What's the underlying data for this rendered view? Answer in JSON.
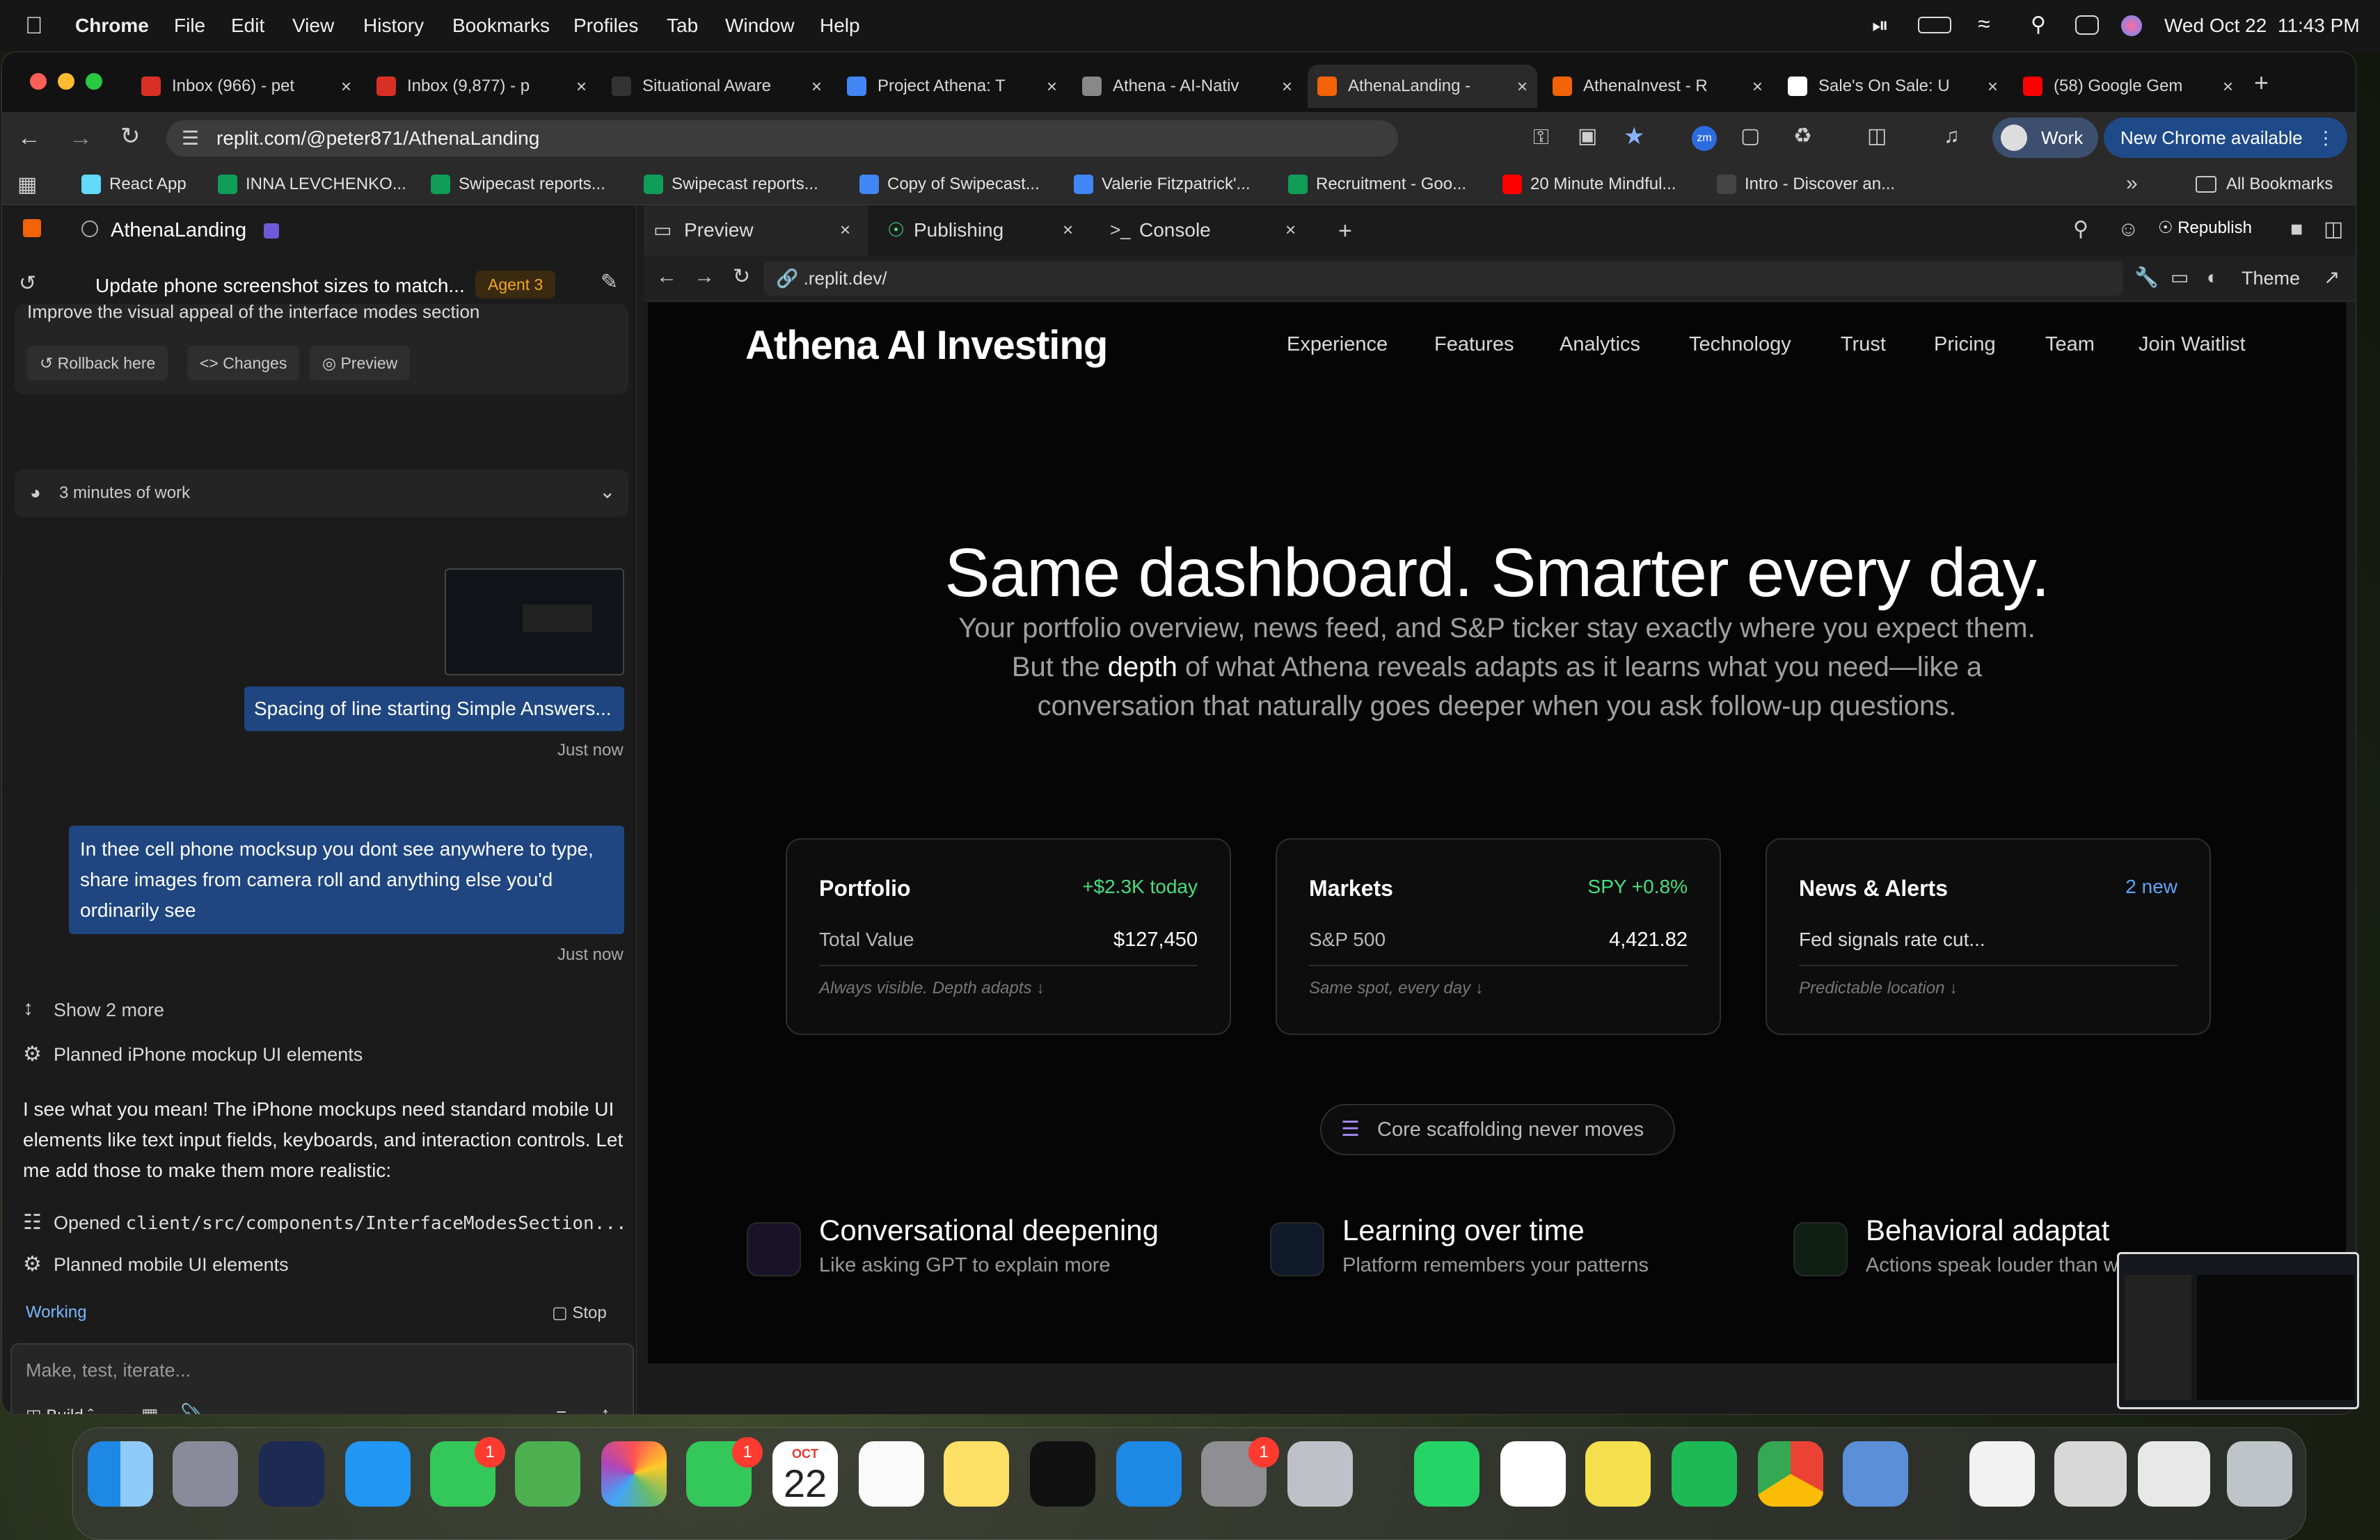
{
  "menubar": {
    "app": "Chrome",
    "items": [
      "File",
      "Edit",
      "View",
      "History",
      "Bookmarks",
      "Profiles",
      "Tab",
      "Window",
      "Help"
    ],
    "datetime": "Wed Oct 22  11:43 PM"
  },
  "tabs": [
    {
      "label": "Inbox (966) - pet",
      "color": "#d93025"
    },
    {
      "label": "Inbox (9,877) - p",
      "color": "#d93025"
    },
    {
      "label": "Situational Aware",
      "color": "#333333"
    },
    {
      "label": "Project Athena: T",
      "color": "#4285f4"
    },
    {
      "label": "Athena - AI-Nativ",
      "color": "#888888"
    },
    {
      "label": "AthenaLanding -",
      "color": "#f26207"
    },
    {
      "label": "AthenaInvest - R",
      "color": "#f26207"
    },
    {
      "label": "Sale's On Sale: U",
      "color": "#ffffff"
    },
    {
      "label": "(58) Google Gem",
      "color": "#ff0000"
    }
  ],
  "toolbar": {
    "url": "replit.com/@peter871/AthenaLanding",
    "profile_label": "Work",
    "update_label": "New Chrome available"
  },
  "bookmarks": [
    {
      "label": "React App",
      "color": "#61dafb"
    },
    {
      "label": "INNA LEVCHENKO...",
      "color": "#0f9d58"
    },
    {
      "label": "Swipecast reports...",
      "color": "#0f9d58"
    },
    {
      "label": "Swipecast reports...",
      "color": "#0f9d58"
    },
    {
      "label": "Copy of Swipecast...",
      "color": "#4285f4"
    },
    {
      "label": "Valerie Fitzpatrick'...",
      "color": "#4285f4"
    },
    {
      "label": "Recruitment - Goo...",
      "color": "#0f9d58"
    },
    {
      "label": "20 Minute Mindful...",
      "color": "#ff0000"
    },
    {
      "label": "Intro - Discover an...",
      "color": "#444444"
    }
  ],
  "bookmarks_all": "All Bookmarks",
  "replit": {
    "project": "AthenaLanding",
    "thread_title": "Update phone screenshot sizes to match...",
    "agent_badge": "Agent 3",
    "cut_text": "Improve the visual appeal of the interface modes section",
    "rollback": "Rollback here",
    "changes": "Changes",
    "preview": "Preview",
    "work_time": "3 minutes of work",
    "msg1": "Spacing of line starting Simple Answers...",
    "msg1_time": "Just now",
    "msg2": "In thee cell phone mocksup you dont see anywhere to type, share images from camera roll and anything else you'd ordinarily see",
    "msg2_time": "Just now",
    "show_more": "Show 2 more",
    "planned1": "Planned iPhone mockup UI elements",
    "agent_text": "I see what you mean! The iPhone mockups need standard mobile UI elements like text input fields, keyboards, and interaction controls. Let me add those to make them more realistic:",
    "opened_label": "Opened",
    "opened_file": "client/src/components/InterfaceModesSection...",
    "planned2": "Planned mobile UI elements",
    "status": "Working",
    "stop": "Stop",
    "input_placeholder": "Make, test, iterate...",
    "build": "Build"
  },
  "workspace": {
    "tab_preview": "Preview",
    "tab_publishing": "Publishing",
    "tab_console": "Console",
    "republish": "Republish",
    "preview_url": ".replit.dev/",
    "theme": "Theme"
  },
  "site": {
    "logo": "Athena AI Investing",
    "nav": [
      "Experience",
      "Features",
      "Analytics",
      "Technology",
      "Trust",
      "Pricing",
      "Team",
      "Join Waitlist"
    ],
    "headline": "Same dashboard. Smarter every day.",
    "sub_before": "Your portfolio overview, news feed, and S&P ticker stay exactly where you expect them. But the ",
    "sub_em": "depth",
    "sub_after": " of what Athena reveals adapts as it learns what you need—like a conversation that naturally goes deeper when you ask follow-up questions.",
    "cards": [
      {
        "title": "Portfolio",
        "badge": "+$2.3K today",
        "badge_color": "#4ade80",
        "label": "Total Value",
        "value": "$127,450",
        "foot": "Always visible. Depth adapts ↓"
      },
      {
        "title": "Markets",
        "badge": "SPY +0.8%",
        "badge_color": "#4ade80",
        "label": "S&P 500",
        "value": "4,421.82",
        "foot": "Same spot, every day ↓"
      },
      {
        "title": "News & Alerts",
        "badge": "2 new",
        "badge_color": "#60a5fa",
        "label": "Fed signals rate cut...",
        "value": "",
        "foot": "Predictable location ↓"
      }
    ],
    "pill": "Core scaffolding never moves",
    "features": [
      {
        "title": "Conversational deepening",
        "sub": "Like asking GPT to explain more",
        "color": "#a78bfa"
      },
      {
        "title": "Learning over time",
        "sub": "Platform remembers your patterns",
        "color": "#60a5fa"
      },
      {
        "title": "Behavioral adaptat",
        "sub": "Actions speak louder than w",
        "color": "#4ade80"
      }
    ]
  },
  "dock": {
    "calendar_month": "OCT",
    "calendar_day": "22",
    "badges": [
      "1",
      "1",
      "1"
    ]
  }
}
